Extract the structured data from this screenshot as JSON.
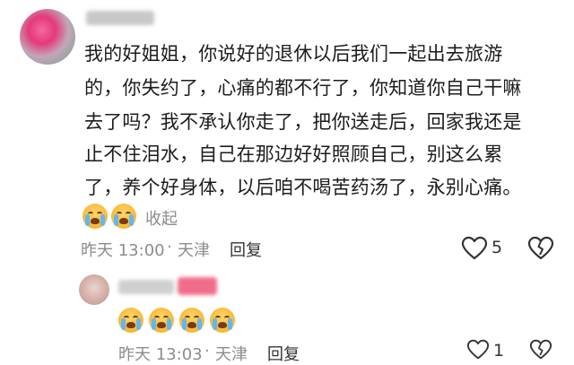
{
  "comment1": {
    "lines": [
      "我的好姐姐，你说好的退休以后我们一起出去旅游",
      "的，你失约了，心痛的都不行了，你知道你自己干嘛",
      "去了吗？我不承认你走了，把你送走后，回家我还是",
      "止不住泪水，自己在那边好好照顾自己，别这么累",
      "了，养个好身体，以后咱不喝苦药汤了，永别心痛。"
    ],
    "collapse_label": "收起",
    "time": "昨天 13:00",
    "separator": "·",
    "location": "天津",
    "reply_label": "回复",
    "like_count": "5"
  },
  "reply1": {
    "time": "昨天 13:03",
    "separator": "·",
    "location": "天津",
    "reply_label": "回复",
    "like_count": "1"
  },
  "icons": [
    "loudly-crying-emoji",
    "heart-outline-icon",
    "broken-heart-icon"
  ],
  "colors": {
    "text": "#1c1c1c",
    "muted": "#8c8c8c",
    "emoji": "#f7b733",
    "badge": "#f06d8a"
  }
}
